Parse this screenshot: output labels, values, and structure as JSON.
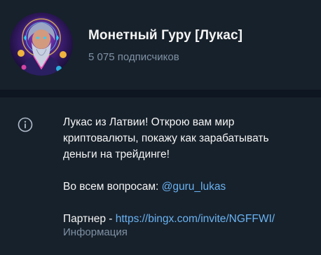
{
  "channel": {
    "name": "Монетный Гуру [Лукас]",
    "subscribers": "5 075 подписчиков",
    "avatar_icon": "guru-avatar-icon"
  },
  "info": {
    "icon": "info-icon",
    "description_lines": [
      "Лукас из Латвии! Открою вам мир",
      "криптовалюты, покажу как зарабатывать",
      "деньги на трейдинге!"
    ],
    "questions_prefix": "Во всем вопросам: ",
    "questions_link": "@guru_lukas",
    "partner_prefix": "Партнер - ",
    "partner_link": "https://bingx.com/invite/NGFFWI/",
    "label": "Информация"
  },
  "colors": {
    "background": "#17212b",
    "divider": "#0e1621",
    "link": "#6ab3f3",
    "secondary_text": "#7f91a4"
  }
}
